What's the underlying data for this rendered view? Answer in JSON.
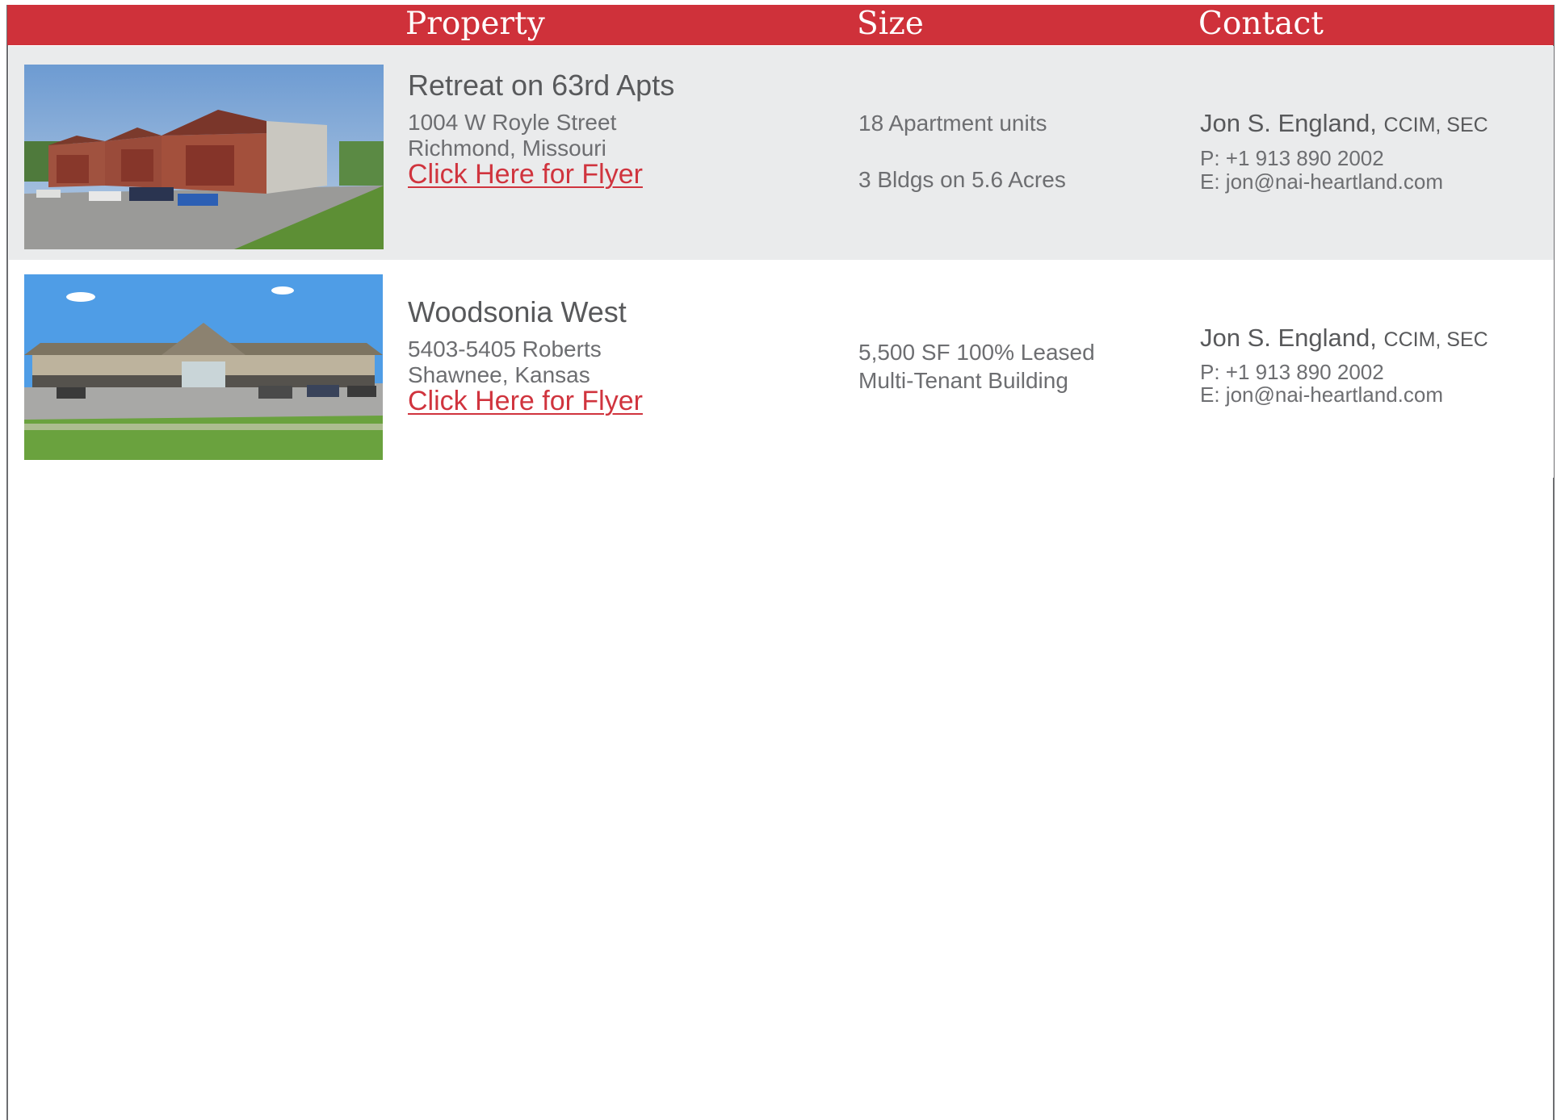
{
  "header": {
    "property_label": "Property",
    "size_label": "Size",
    "contact_label": "Contact"
  },
  "colors": {
    "accent": "#cf313a",
    "row_shade": "#eaebec",
    "text": "#58595b",
    "link": "#d0343e"
  },
  "listings": [
    {
      "name": "Retreat on 63rd Apts",
      "address_line1": "1004 W Royle Street",
      "address_line2": "Richmond, Missouri",
      "flyer_link": "Click Here for Flyer",
      "size_line1": "18 Apartment units",
      "size_line2": "3 Bldgs on 5.6 Acres",
      "contact_name": "Jon S. England,",
      "contact_credentials": "CCIM, SEC",
      "contact_phone": "P: +1 913 890 2002",
      "contact_email": "E: jon@nai-heartland.com"
    },
    {
      "name": "Woodsonia West",
      "address_line1": "5403-5405 Roberts",
      "address_line2": "Shawnee, Kansas",
      "flyer_link": "Click Here for Flyer",
      "size_line1": "5,500 SF 100% Leased",
      "size_line2": "Multi-Tenant Building",
      "contact_name": "Jon S. England,",
      "contact_credentials": "CCIM, SEC",
      "contact_phone": "P: +1 913 890 2002",
      "contact_email": "E: jon@nai-heartland.com"
    }
  ]
}
